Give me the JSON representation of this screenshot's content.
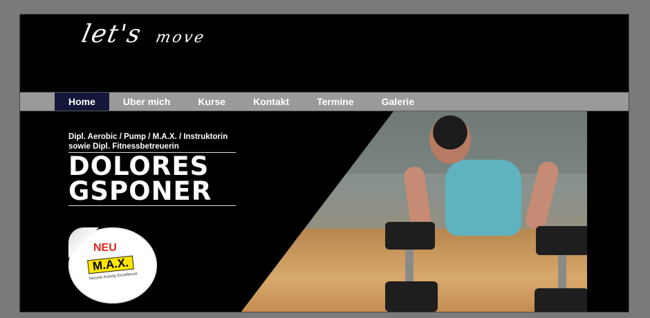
{
  "logo": {
    "word1": "let's",
    "word2": "move"
  },
  "nav": {
    "items": [
      {
        "label": "Home"
      },
      {
        "label": "Uber mich"
      },
      {
        "label": "Kurse"
      },
      {
        "label": "Kontakt"
      },
      {
        "label": "Termine"
      },
      {
        "label": "Galerie"
      }
    ]
  },
  "hero": {
    "tagline_line1": "Dipl. Aerobic / Pump / M.A.X. / Instruktorin",
    "tagline_line2": "sowie Dipl. Fitnessbetreuerin",
    "name_line1": "DOLORES",
    "name_line2": "GSPONER",
    "badge": {
      "neu": "NEU",
      "max": "M.A.X.",
      "sub": "Muscle Activity Excellence"
    }
  },
  "colors": {
    "page_bg": "#7a7a7a",
    "frame_bg": "#000000",
    "nav_bg": "#9a9a9a",
    "nav_active": "#15173a",
    "badge_red": "#e0261b",
    "badge_yellow": "#ffe600"
  }
}
